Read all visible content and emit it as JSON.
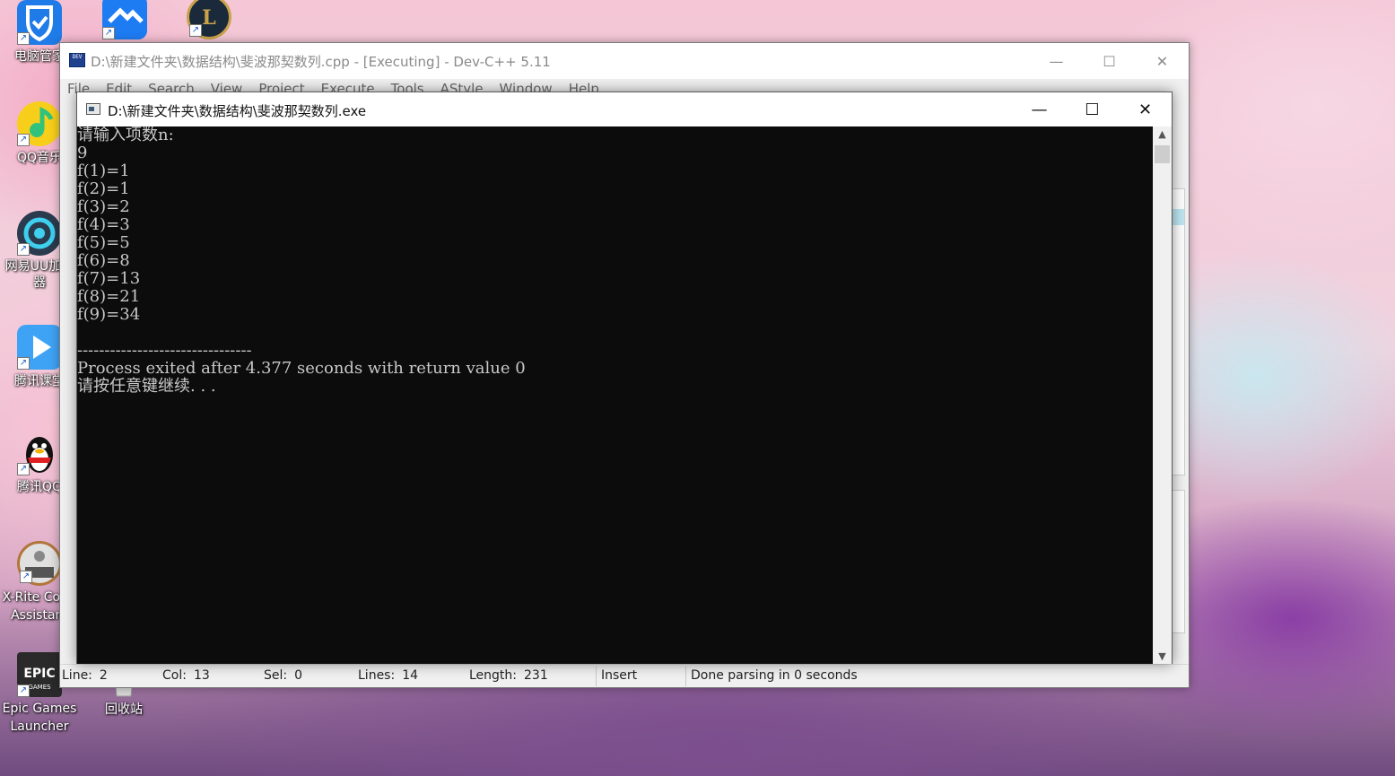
{
  "desktop": {
    "icons": [
      {
        "label": "电脑管家",
        "icon": "shield-icon",
        "color": "#1f7be8"
      },
      {
        "label": "QQ音乐",
        "icon": "music-note-icon",
        "color": "#f7cf1a"
      },
      {
        "label": "网易UU加速器",
        "icon": "uu-accelerator-icon",
        "color": "#2a3b4d"
      },
      {
        "label": "腾讯课堂",
        "icon": "play-icon",
        "color": "#3fa3f5"
      },
      {
        "label": "腾讯QQ",
        "icon": "penguin-icon",
        "color": "#111111"
      },
      {
        "label": "X-Rite Color Assistant",
        "icon": "color-calibration-icon",
        "color": "#e0e0e0"
      },
      {
        "label": "Epic Games Launcher",
        "icon": "epic-games-icon",
        "color": "#2a2a2a"
      },
      {
        "label": "回收站",
        "icon": "recycle-bin-icon",
        "color": "#d9d9d9"
      }
    ],
    "top_icons": [
      {
        "icon": "lark-icon",
        "color": "#1d7cf2"
      },
      {
        "icon": "league-of-legends-icon",
        "color": "#c9a24a"
      }
    ]
  },
  "devcpp": {
    "title": "D:\\新建文件夹\\数据结构\\斐波那契数列.cpp - [Executing] - Dev-C++ 5.11",
    "menu": [
      "File",
      "Edit",
      "Search",
      "View",
      "Project",
      "Execute",
      "Tools",
      "AStyle",
      "Window",
      "Help"
    ],
    "status": {
      "line_label": "Line:",
      "line_value": "2",
      "col_label": "Col:",
      "col_value": "13",
      "sel_label": "Sel:",
      "sel_value": "0",
      "lines_label": "Lines:",
      "lines_value": "14",
      "length_label": "Length:",
      "length_value": "231",
      "mode": "Insert",
      "message": "Done parsing in 0 seconds"
    }
  },
  "console": {
    "title": "D:\\新建文件夹\\数据结构\\斐波那契数列.exe",
    "lines": [
      "请输入项数n:",
      "9",
      "f(1)=1",
      "f(2)=1",
      "f(3)=2",
      "f(4)=3",
      "f(5)=5",
      "f(6)=8",
      "f(7)=13",
      "f(8)=21",
      "f(9)=34",
      "",
      "--------------------------------",
      "Process exited after 4.377 seconds with return value 0",
      "请按任意键继续. . ."
    ]
  }
}
